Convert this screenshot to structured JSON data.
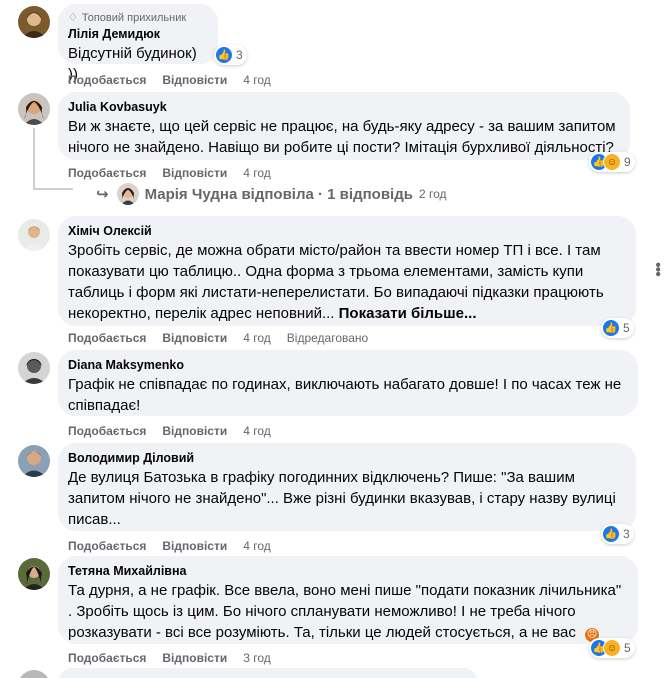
{
  "comments": [
    {
      "badge": "Топовий прихильник",
      "author": "Лілія Демидюк",
      "text": "Відсутній будинок) ))",
      "like_label": "Подобається",
      "reply_label": "Відповісти",
      "time": "4 год",
      "reactions": "3"
    },
    {
      "author": "Julia Kovbasuyk",
      "text": "Ви ж знаєте, що цей сервіс не працює, на будь-яку адресу - за вашим запитом нічого не знайдено. Навіщо ви робите ці пости? Імітація бурхливої діяльності?",
      "like_label": "Подобається",
      "reply_label": "Відповісти",
      "time": "4 год",
      "reactions": "9",
      "reply_summary": {
        "text": "Марія Чудна відповіла · 1 відповідь",
        "time": "2 год"
      }
    },
    {
      "author": "Хіміч Олексій",
      "text": "Зробіть сервіс, де можна обрати місто/район та ввести номер ТП і все. І там показувати цю таблицю.. Одна форма з трьома елементами, замість купи таблиць і форм які листати-неперелистати. Бо випадаючі підказки працюють некоректно, перелік адрес неповний...",
      "see_more": "Показати більше...",
      "like_label": "Подобається",
      "reply_label": "Відповісти",
      "time": "4 год",
      "edited": "Відредаговано",
      "reactions": "5"
    },
    {
      "author": "Diana Maksymenko",
      "text": "Графік не співпадає по годинах, виключають набагато довше! І по часах теж не співпадає!",
      "like_label": "Подобається",
      "reply_label": "Відповісти",
      "time": "4 год"
    },
    {
      "author": "Володимир Діловий",
      "text": "Де вулиця Батозька в графіку погодинних відключень? Пише: \"За вашим запитом нічого не знайдено\"... Вже різні будинки вказував, і стару назву вулиці писав...",
      "like_label": "Подобається",
      "reply_label": "Відповісти",
      "time": "4 год",
      "reactions": "3"
    },
    {
      "author": "Тетяна Михайлівна",
      "text": "Та дурня, а не графік. Все ввела, воно мені пише \"подати показник лічильника\" . Зробіть щось із цим. Бо нічого спланувати неможливо! І не треба нічого розказувати - всі все розуміють. Та, тільки це людей стосується, а не вас",
      "like_label": "Подобається",
      "reply_label": "Відповісти",
      "time": "3 год",
      "reactions": "5"
    }
  ],
  "icons": {
    "badge": "diamond-icon",
    "like": "like-icon",
    "care": "care-icon",
    "angry": "angry-icon",
    "more": "more-options-icon",
    "reply_arrow": "reply-arrow-icon"
  },
  "colors": {
    "bubble": "#f0f2f5",
    "meta": "#65676b",
    "like": "#1877f2"
  }
}
